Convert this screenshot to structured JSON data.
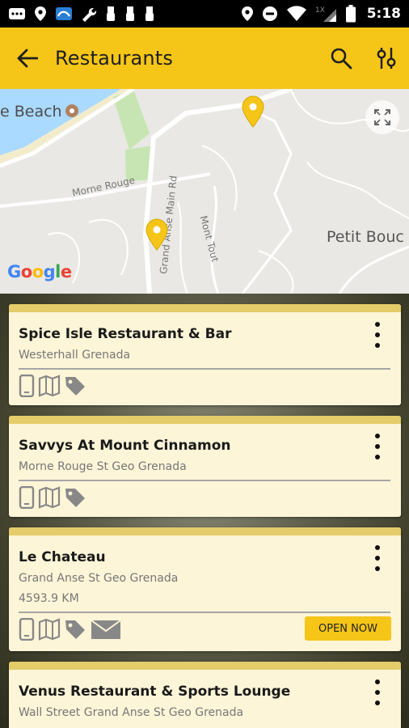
{
  "status_bar": {
    "time": "5:18",
    "icons": [
      "notification-icon",
      "location-icon",
      "usb-icon",
      "wrench-icon",
      "usb-icon",
      "usb-icon",
      "usb-icon",
      "location-icon",
      "do-not-disturb-icon",
      "wifi-icon",
      "signal-icon",
      "battery-icon"
    ]
  },
  "app_bar": {
    "title": "Restaurants",
    "back_icon": "arrow-back-icon",
    "actions": [
      "search-icon",
      "filter-icon"
    ],
    "color": "#f5c518"
  },
  "map": {
    "beach_label": "e Beach",
    "petit_label": "Petit Bouc",
    "road_morne_rouge": "Morne Rouge",
    "road_grand_anse": "Grand Anse Main Rd",
    "road_mont_tout": "Mont Tout",
    "google_logo": "Google",
    "pin_color": "#f5c518"
  },
  "restaurants": [
    {
      "name": "Spice Isle Restaurant & Bar",
      "address": "Westerhall Grenada",
      "icons": [
        "phone-icon",
        "map-icon",
        "tag-icon"
      ]
    },
    {
      "name": "Savvys At Mount Cinnamon",
      "address": "Morne Rouge St Geo Grenada",
      "icons": [
        "phone-icon",
        "map-icon",
        "tag-icon"
      ]
    },
    {
      "name": "Le Chateau",
      "address": "Grand Anse St Geo Grenada",
      "distance": "4593.9 KM",
      "icons": [
        "phone-icon",
        "map-icon",
        "tag-icon",
        "mail-icon"
      ],
      "open_label": "OPEN NOW"
    },
    {
      "name": "Venus Restaurant & Sports Lounge",
      "address": "Wall Street Grand Anse St Geo Grenada"
    }
  ]
}
